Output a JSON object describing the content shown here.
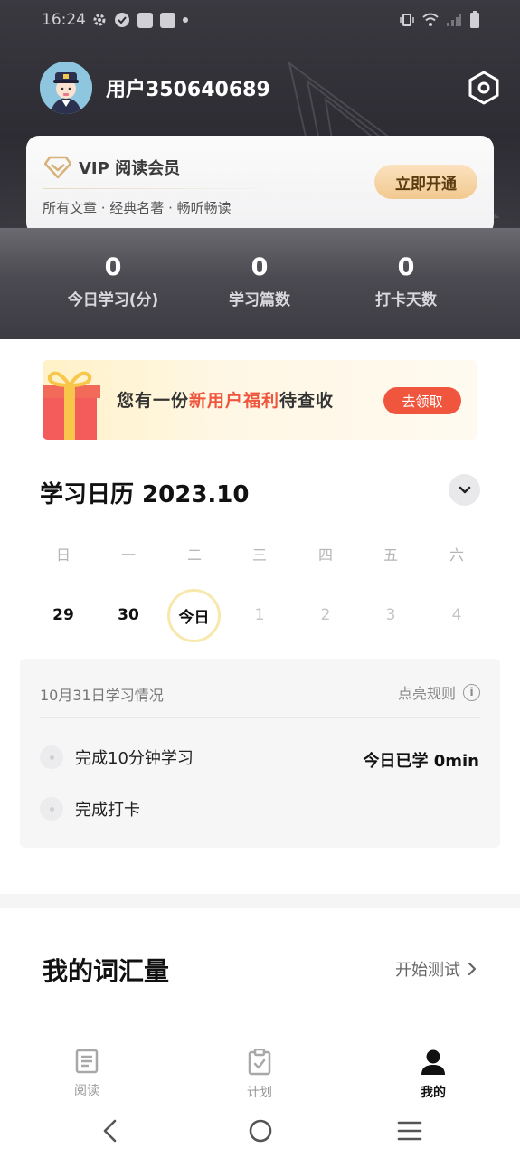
{
  "status_bar": {
    "time": "16:24"
  },
  "profile": {
    "username": "用户350640689"
  },
  "vip": {
    "title": "VIP 阅读会员",
    "subtitle": "所有文章 · 经典名著 · 畅听畅读",
    "button": "立即开通"
  },
  "stats": [
    {
      "value": "0",
      "label": "今日学习(分)"
    },
    {
      "value": "0",
      "label": "学习篇数"
    },
    {
      "value": "0",
      "label": "打卡天数"
    }
  ],
  "promo": {
    "prefix": "您有一份",
    "highlight": "新用户福利",
    "suffix": "待查收",
    "button": "去领取"
  },
  "calendar": {
    "title": "学习日历 2023.10",
    "weekdays": [
      "日",
      "一",
      "二",
      "三",
      "四",
      "五",
      "六"
    ],
    "dates": [
      "29",
      "30",
      "今日",
      "1",
      "2",
      "3",
      "4"
    ]
  },
  "study": {
    "date_label": "10月31日学习情况",
    "rules_label": "点亮规则",
    "task1": "完成10分钟学习",
    "task2": "完成打卡",
    "today_learned": "今日已学 0min"
  },
  "vocab": {
    "title": "我的词汇量",
    "test_label": "开始测试"
  },
  "tabs": [
    {
      "label": "阅读",
      "icon": "document-icon"
    },
    {
      "label": "计划",
      "icon": "clipboard-check-icon"
    },
    {
      "label": "我的",
      "icon": "person-icon"
    }
  ],
  "colors": {
    "accent": "#f0563e",
    "vip_gold": "#f1c98f",
    "header_dark": "#2d2c33"
  }
}
